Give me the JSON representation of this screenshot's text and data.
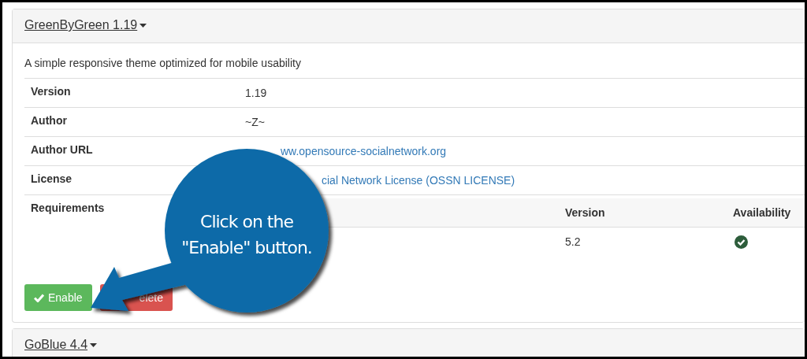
{
  "panels": [
    {
      "title": "GreenByGreen 1.19",
      "description": "A simple responsive theme optimized for mobile usability",
      "details": [
        {
          "label": "Version",
          "kind": "text",
          "value": "1.19"
        },
        {
          "label": "Author",
          "kind": "text",
          "value": "~Z~"
        },
        {
          "label": "Author URL",
          "kind": "link",
          "value": "ww.opensource-socialnetwork.org"
        },
        {
          "label": "License",
          "kind": "link",
          "value": "cial Network License (OSSN LICENSE)"
        },
        {
          "label": "Requirements",
          "kind": "table",
          "columns": [
            "Version",
            "Availability"
          ],
          "rows": [
            {
              "version": "5.2",
              "available": true
            }
          ]
        }
      ],
      "buttons": [
        {
          "label": "Enable",
          "kind": "enable"
        },
        {
          "label": "elete",
          "kind": "delete"
        }
      ]
    },
    {
      "title": "GoBlue 4.4"
    }
  ],
  "callout": {
    "text": "Click on the \"Enable\" button."
  }
}
